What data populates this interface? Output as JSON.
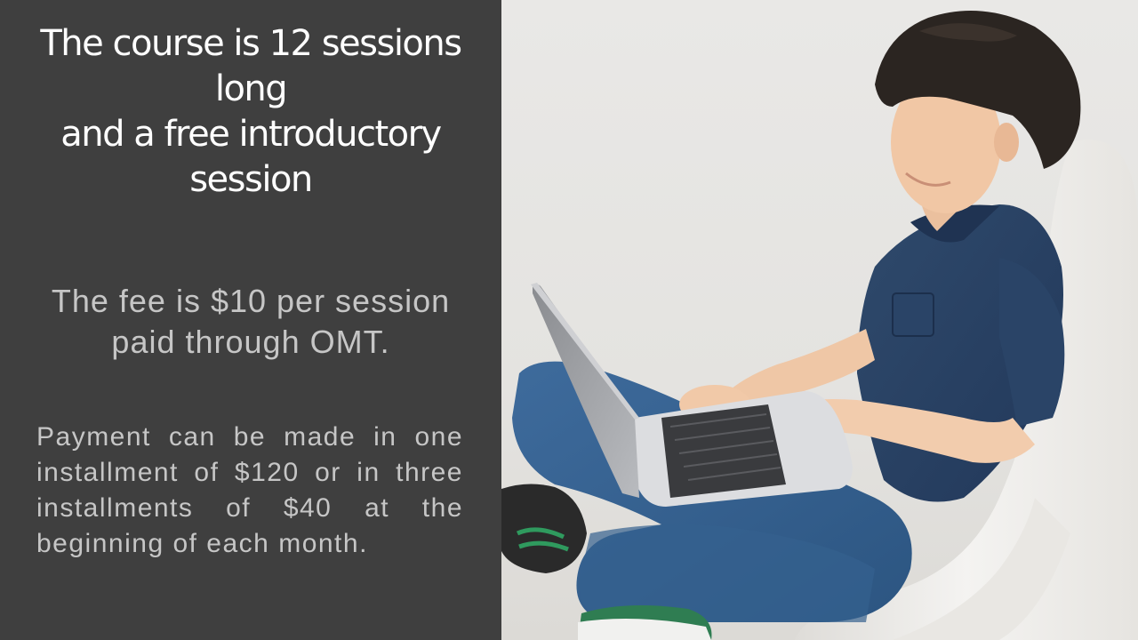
{
  "slide": {
    "title": "The course is 12 sessions\nlong\nand a free introductory\nsession",
    "fee": "The fee is $10 per session\npaid through OMT.",
    "payment": "Payment can be made in one installment of $120 or in three installments of $40 at the beginning of each month."
  },
  "colors": {
    "panel_background": "#3f3f3f",
    "title_text": "#ffffff",
    "body_text": "#c6c6c6"
  },
  "photo": {
    "subject": "boy-with-laptop-photo"
  }
}
